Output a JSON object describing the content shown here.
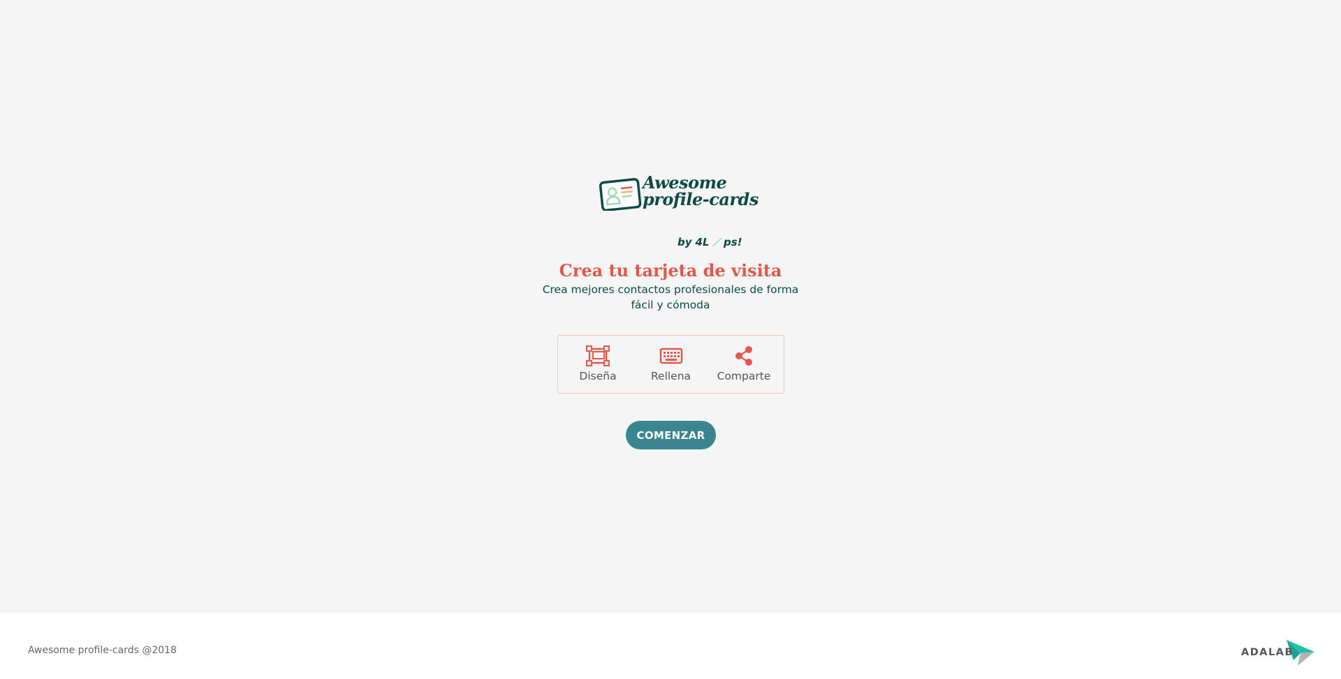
{
  "logo": {
    "line1": "Awesome",
    "line2": "profile-cards",
    "byline": "by",
    "team_a": "4L",
    "team_b": "ps!"
  },
  "hero": {
    "title": "Crea tu tarjeta de visita",
    "subtitle": "Crea mejores contactos profesionales de forma fácil y cómoda"
  },
  "steps": [
    {
      "label": "Diseña",
      "icon": "design-icon"
    },
    {
      "label": "Rellena",
      "icon": "keyboard-icon"
    },
    {
      "label": "Comparte",
      "icon": "share-icon"
    }
  ],
  "cta": {
    "label": "COMENZAR"
  },
  "footer": {
    "copyright": "Awesome profile-cards @2018",
    "brand": "ADALAB"
  },
  "colors": {
    "background": "#f5f5f5",
    "brand_dark": "#0e4a45",
    "accent_red": "#e3584a",
    "button": "#3b8590",
    "step_border": "#efc3ad"
  }
}
